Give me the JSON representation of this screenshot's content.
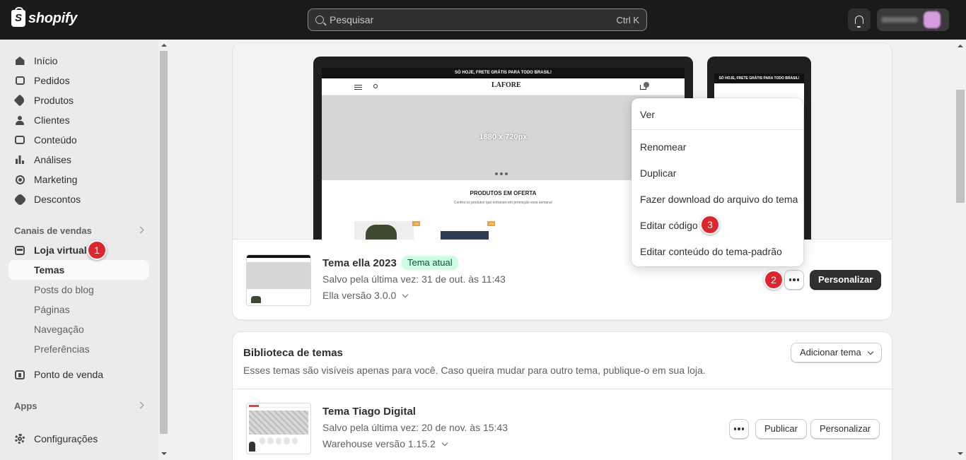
{
  "topbar": {
    "logo_text": "shopify",
    "search_placeholder": "Pesquisar",
    "search_shortcut": "Ctrl K"
  },
  "sidebar": {
    "items": [
      {
        "label": "Início",
        "icon": "home-icon"
      },
      {
        "label": "Pedidos",
        "icon": "inbox-icon"
      },
      {
        "label": "Produtos",
        "icon": "tag-icon"
      },
      {
        "label": "Clientes",
        "icon": "person-icon"
      },
      {
        "label": "Conteúdo",
        "icon": "content-icon"
      },
      {
        "label": "Análises",
        "icon": "bar-chart-icon"
      },
      {
        "label": "Marketing",
        "icon": "target-icon"
      },
      {
        "label": "Descontos",
        "icon": "discount-icon"
      }
    ],
    "sales_channels_title": "Canais de vendas",
    "online_store": "Loja virtual",
    "sub_items": [
      "Temas",
      "Posts do blog",
      "Páginas",
      "Navegação",
      "Preferências"
    ],
    "point_of_sale": "Ponto de venda",
    "apps_title": "Apps",
    "settings": "Configurações"
  },
  "badges": {
    "one": "1",
    "two": "2",
    "three": "3"
  },
  "current_theme": {
    "preview": {
      "promo": "SÓ HOJE, FRETE GRÁTIS PARA TODO BRASIL!",
      "logo": "LAFORE",
      "hero": "1880 x 720px",
      "offers_title": "PRODUTOS EM OFERTA",
      "offers_sub": "Confira os produtos que entraram em promoção essa semana!",
      "discount_tag": "-0%"
    },
    "name": "Tema ella 2023",
    "status": "Tema atual",
    "saved": "Salvo pela última vez: 31 de out. às 11:43",
    "version": "Ella versão 3.0.0",
    "customize": "Personalizar"
  },
  "menu": {
    "items": [
      "Ver",
      "Renomear",
      "Duplicar",
      "Fazer download do arquivo do tema",
      "Editar código",
      "Editar conteúdo do tema-padrão"
    ]
  },
  "library": {
    "title": "Biblioteca de temas",
    "add_theme": "Adicionar tema",
    "description": "Esses temas são visíveis apenas para você. Caso queira mudar para outro tema, publique-o em sua loja.",
    "theme": {
      "name": "Tema Tiago Digital",
      "saved": "Salvo pela última vez: 20 de nov. às 15:43",
      "version": "Warehouse versão 1.15.2",
      "publish": "Publicar",
      "customize": "Personalizar"
    }
  },
  "colors": {
    "topbar": "#1a1a1a",
    "badge": "#e0242b",
    "current_pill": "#cdfee1"
  }
}
